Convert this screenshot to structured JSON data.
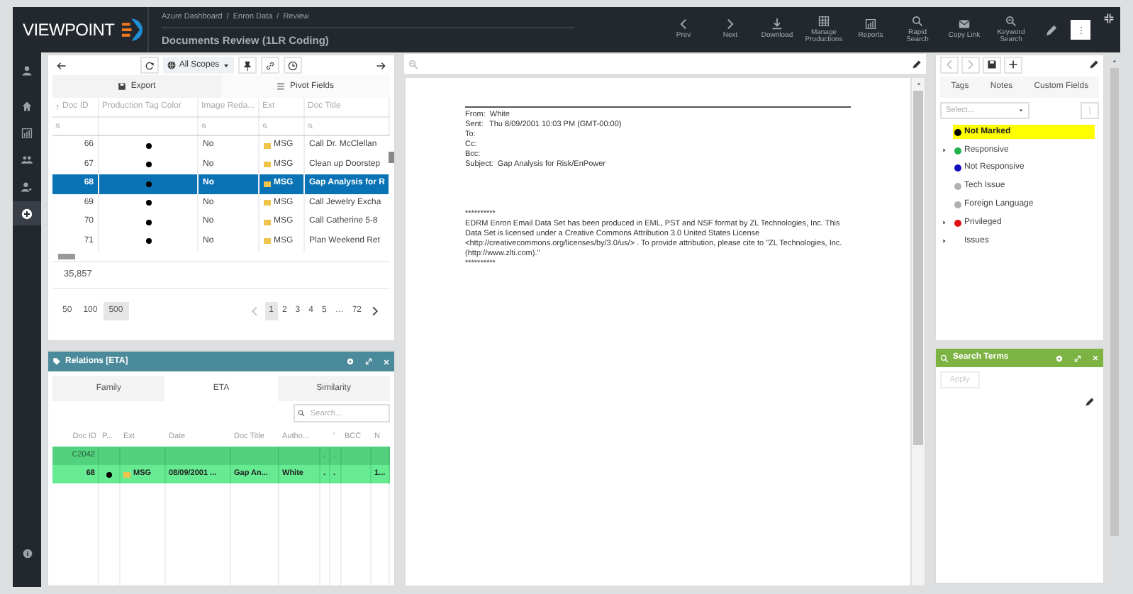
{
  "header": {
    "logo": "VIEWPOINT",
    "breadcrumb": [
      {
        "label": "Azure Dashboard",
        "separator": "/"
      },
      {
        "label": "Enron Data",
        "separator": "/"
      },
      {
        "label": "Review"
      }
    ],
    "title": "Documents Review (1LR Coding)",
    "actions": [
      {
        "kind": "prev",
        "label": "Prev"
      },
      {
        "kind": "next",
        "label": "Next"
      },
      {
        "kind": "download",
        "label": "Download"
      },
      {
        "kind": "table",
        "label": "Manage Productions"
      },
      {
        "kind": "chart",
        "label": "Reports"
      },
      {
        "kind": "search",
        "label": "Rapid Search"
      },
      {
        "kind": "mail",
        "label": "Copy Link"
      },
      {
        "kind": "zoom",
        "label": "Keyword Search"
      }
    ]
  },
  "rail": [
    {
      "kind": "user",
      "selected": false
    },
    {
      "kind": "home",
      "selected": false
    },
    {
      "kind": "chart",
      "selected": false
    },
    {
      "kind": "group",
      "selected": false
    },
    {
      "kind": "userkey",
      "selected": false
    },
    {
      "kind": "plus",
      "selected": true
    }
  ],
  "grid": {
    "scope": "All Scopes",
    "tabs": [
      {
        "label": "Export",
        "kind": "export"
      },
      {
        "label": "Pivot Fields",
        "kind": "pivot"
      }
    ],
    "columns": [
      "Doc ID",
      "Production Tag Color",
      "Image Reda...",
      "Ext",
      "Doc Title"
    ],
    "rows": [
      {
        "doc_id": "66",
        "redacted": "No",
        "ext": "MSG",
        "title": "Call Dr. McClellan",
        "selected": false
      },
      {
        "doc_id": "67",
        "redacted": "No",
        "ext": "MSG",
        "title": "Clean up Doorstep",
        "selected": false
      },
      {
        "doc_id": "68",
        "redacted": "No",
        "ext": "MSG",
        "title": "Gap Analysis for R",
        "selected": true
      },
      {
        "doc_id": "69",
        "redacted": "No",
        "ext": "MSG",
        "title": "Call Jewelry Excha",
        "selected": false
      },
      {
        "doc_id": "70",
        "redacted": "No",
        "ext": "MSG",
        "title": "Call Catherine 5-8",
        "selected": false
      },
      {
        "doc_id": "71",
        "redacted": "No",
        "ext": "MSG",
        "title": "Plan Weekend Ret",
        "selected": false
      }
    ],
    "total": "35,857",
    "page_sizes": [
      {
        "label": "50",
        "selected": false
      },
      {
        "label": "100",
        "selected": false
      },
      {
        "label": "500",
        "selected": true
      }
    ],
    "pages": [
      {
        "label": "1",
        "selected": true
      },
      {
        "label": "2",
        "selected": false
      },
      {
        "label": "3",
        "selected": false
      },
      {
        "label": "4",
        "selected": false
      },
      {
        "label": "5",
        "selected": false
      },
      {
        "label": "…",
        "selected": false
      },
      {
        "label": "72",
        "selected": false
      }
    ]
  },
  "relations": {
    "title": "Relations [ETA]",
    "tabs": [
      {
        "label": "Family",
        "selected": false
      },
      {
        "label": "ETA",
        "selected": true
      },
      {
        "label": "Similarity",
        "selected": false
      }
    ],
    "search": {
      "placeholder": "Search..."
    },
    "columns": [
      "Doc ID",
      "P...",
      "Ext",
      "Date",
      "Doc Title",
      "Autho...",
      "",
      "'",
      "BCC",
      "N"
    ],
    "group": {
      "label": "C2042",
      "cells": [
        "",
        "",
        " ",
        "",
        "",
        "",
        ".",
        ".",
        "",
        ""
      ]
    },
    "row": {
      "doc_id": "68",
      "ext": "MSG",
      "date": "08/09/2001 ...",
      "title": "Gap An...",
      "author": "White",
      "col_7": ".",
      "col_8": ".",
      "col_10": "1..."
    }
  },
  "document": {
    "fields": [
      {
        "label": "From:",
        "value": "White"
      },
      {
        "label": "Sent:",
        "value": "Thu 8/09/2001 10:03 PM (GMT-00:00)"
      },
      {
        "label": "To:"
      },
      {
        "label": "Cc:"
      },
      {
        "label": "Bcc:"
      },
      {
        "label": "Subject:",
        "value": "Gap Analysis for Risk/EnPower"
      }
    ],
    "body": [
      "**********",
      "EDRM Enron Email Data Set has been produced in EML, PST and NSF format by ZL Technologies, Inc. This Data Set is licensed under a Creative Commons Attribution 3.0 United States License <http://creativecommons.org/licenses/by/3.0/us/> . To provide attribution, please cite to \"ZL Technologies, Inc. (http://www.zlti.com).\"",
      "**********"
    ]
  },
  "coding": {
    "tabs": [
      {
        "label": "Tags"
      },
      {
        "label": "Notes"
      },
      {
        "label": "Custom Fields"
      }
    ],
    "select": {
      "placeholder": "Select..."
    },
    "tags": [
      {
        "label": "Not Marked",
        "color": "#000000",
        "selected": true,
        "expandable": false
      },
      {
        "label": "Responsive",
        "color": "#22b14c",
        "selected": false,
        "expandable": true
      },
      {
        "label": "Not Responsive",
        "color": "#1010c0",
        "selected": false,
        "expandable": false
      },
      {
        "label": "Tech Issue",
        "color": "#b0b0b0",
        "selected": false,
        "expandable": false
      },
      {
        "label": "Foreign Language",
        "color": "#b0b0b0",
        "selected": false,
        "expandable": false
      },
      {
        "label": "Privileged",
        "color": "#e01010",
        "selected": false,
        "expandable": true
      },
      {
        "label": "Issues",
        "selected": false,
        "expandable": true
      }
    ]
  },
  "search_terms": {
    "title": "Search Terms",
    "apply": {
      "label": "Apply",
      "disabled": true
    }
  }
}
